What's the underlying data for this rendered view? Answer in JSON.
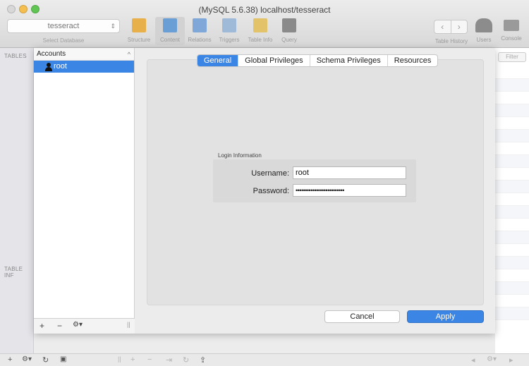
{
  "window": {
    "title": "(MySQL 5.6.38) localhost/tesseract"
  },
  "toolbar": {
    "database": "tesseract",
    "database_label": "Select Database",
    "buttons": [
      {
        "label": "Structure",
        "color": "#e8b04a"
      },
      {
        "label": "Content",
        "color": "#6a9fd6"
      },
      {
        "label": "Relations",
        "color": "#7fa8d8"
      },
      {
        "label": "Triggers",
        "color": "#9fb9d9"
      },
      {
        "label": "Table Info",
        "color": "#e3c36a"
      },
      {
        "label": "Query",
        "color": "#8a8a8a"
      }
    ],
    "table_history_label": "Table History",
    "users_label": "Users",
    "console_label": "Console"
  },
  "sidebar": {
    "tables_label": "TABLES",
    "table_info_label": "TABLE INF"
  },
  "content": {
    "filter_label": "Filter"
  },
  "accounts": {
    "header": "Accounts",
    "items": [
      {
        "name": "root"
      }
    ]
  },
  "tabs": [
    "General",
    "Global Privileges",
    "Schema Privileges",
    "Resources"
  ],
  "login": {
    "title": "Login Information",
    "username_label": "Username:",
    "username_value": "root",
    "password_label": "Password:",
    "password_value": "••••••••••••••••••••••••••"
  },
  "buttons": {
    "cancel": "Cancel",
    "apply": "Apply"
  },
  "colors": {
    "accent": "#3b86e5"
  }
}
